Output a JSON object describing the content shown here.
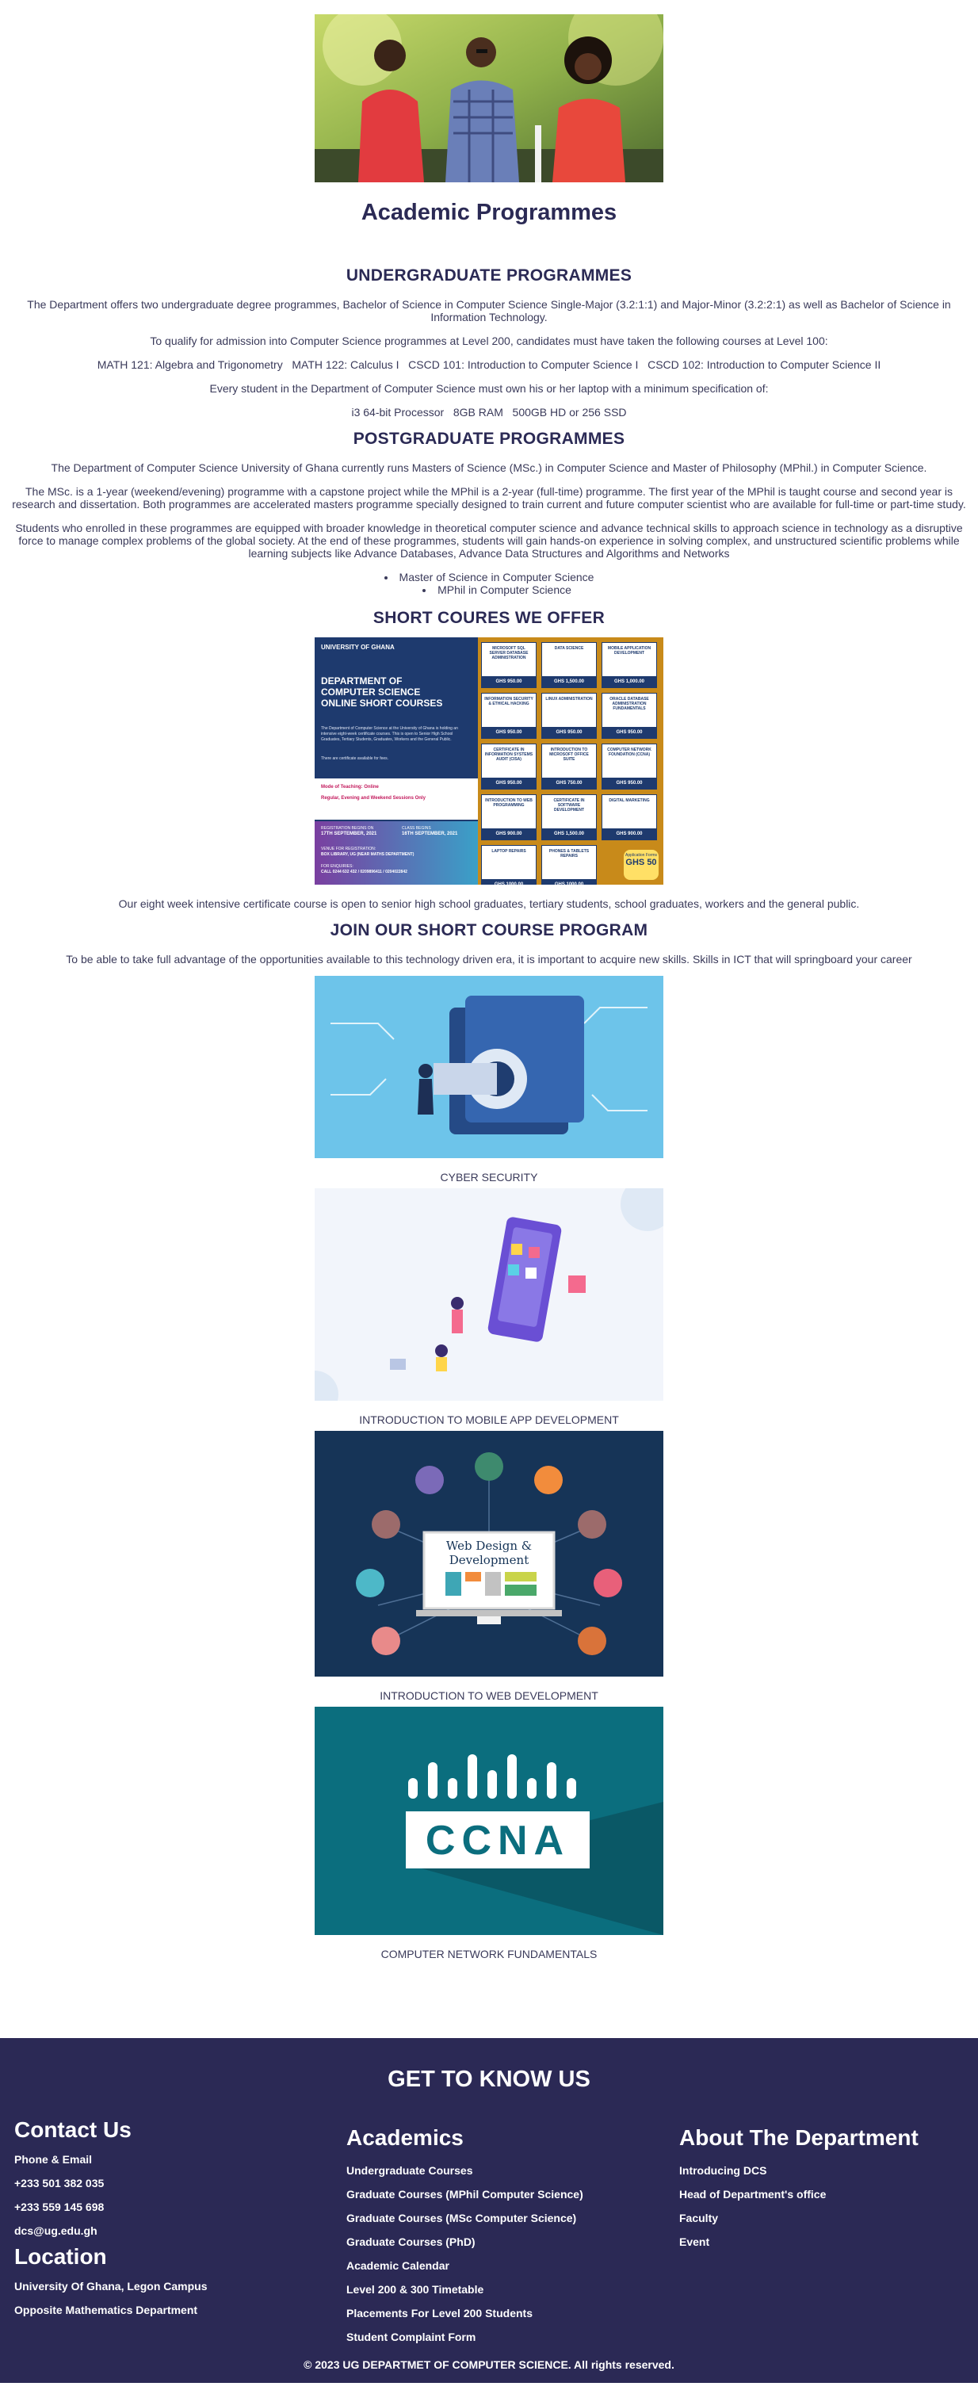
{
  "page": {
    "title": "Academic Programmes"
  },
  "undergrad": {
    "heading": "UNDERGRADUATE PROGRAMMES",
    "p1": "The Department offers two undergraduate degree programmes, Bachelor of Science in Computer Science Single-Major (3.2:1:1) and Major-Minor (3.2:2:1) as well as Bachelor of Science in Information Technology.",
    "p2": "To qualify for admission into Computer Science programmes at Level 200, candidates must have taken the following courses at Level 100:",
    "p3": "MATH 121: Algebra and Trigonometry   MATH 122: Calculus I   CSCD 101: Introduction to Computer Science I   CSCD 102: Introduction to Computer Science II",
    "p4": "Every student in the Department of Computer Science must own his or her laptop with a minimum specification of:",
    "p5": "i3 64-bit Processor   8GB RAM   500GB HD or 256 SSD"
  },
  "postgrad": {
    "heading": "POSTGRADUATE PROGRAMMES",
    "p1": "The Department of Computer Science University of Ghana currently runs Masters of Science (MSc.) in Computer Science and Master of Philosophy (MPhil.) in Computer Science.",
    "p2": "The MSc. is a 1-year (weekend/evening) programme with a capstone project while the MPhil is a 2-year (full-time) programme. The first year of the MPhil is taught course and second year is research and dissertation. Both programmes are accelerated masters programme specially designed to train current and future computer scientist who are available for full-time or part-time study.",
    "p3": "Students who enrolled in these programmes are equipped with broader knowledge in theoretical computer science and advance technical skills to approach science in technology as a disruptive force to manage complex problems of the global society. At the end of these programmes, students will gain hands-on experience in solving complex, and unstructured scientific problems while learning subjects like Advance Databases, Advance Data Structures and Algorithms and Networks",
    "items": [
      "Master of Science in Computer Science",
      "MPhil in Computer Science"
    ]
  },
  "short": {
    "heading": "SHORT COURES WE OFFER",
    "poster": {
      "brand": "UNIVERSITY OF GHANA",
      "title_lines": [
        "DEPARTMENT OF",
        "COMPUTER SCIENCE",
        "ONLINE SHORT COURSES"
      ],
      "intro": "The Department of Computer Science at the University of Ghana is holding an intensive eight-week certificate courses. This is open to Senior High School Graduates, Tertiary Students, Graduates, Workers and the General Public.",
      "contact_note": "There are certificate available for fees.",
      "mode_label": "Mode of Teaching: Online",
      "sessions": "Regular, Evening and Weekend Sessions Only",
      "reg_start_label": "REGISTRATION BEGINS ON",
      "reg_start": "17TH SEPTEMBER, 2021",
      "reg_end_label": "CLASS BEGINS",
      "reg_end": "16TH SEPTEMBER, 2021",
      "venue_label": "VENUE FOR REGISTRATION:",
      "venue": "BOX LIBRARY, UG (NEAR MATHS DEPARTMENT)",
      "enquiries_label": "FOR ENQUIRIES:",
      "enquiries": "CALL 0244 632 432 / 0209896411 / 0204022842",
      "courses": [
        {
          "name": "MICROSOFT SQL SERVER DATABASE ADMINISTRATION",
          "price": "GHS 950.00"
        },
        {
          "name": "DATA SCIENCE",
          "price": "GHS 1,500.00"
        },
        {
          "name": "MOBILE APPLICATION DEVELOPMENT",
          "price": "GHS 1,000.00"
        },
        {
          "name": "INFORMATION SECURITY & ETHICAL HACKING",
          "price": "GHS 950.00"
        },
        {
          "name": "LINUX ADMINISTRATION",
          "price": "GHS 950.00"
        },
        {
          "name": "ORACLE DATABASE ADMINISTRATION FUNDAMENTALS",
          "price": "GHS 950.00"
        },
        {
          "name": "CERTIFICATE IN INFORMATION SYSTEMS AUDIT (CISA)",
          "price": "GHS 950.00"
        },
        {
          "name": "INTRODUCTION TO MICROSOFT OFFICE SUITE",
          "price": "GHS 750.00"
        },
        {
          "name": "COMPUTER NETWORK FOUNDATION (CCNA)",
          "price": "GHS 950.00"
        },
        {
          "name": "INTRODUCTION TO WEB PROGRAMMING",
          "price": "GHS 900.00"
        },
        {
          "name": "CERTIFICATE IN SOFTWARE DEVELOPMENT",
          "price": "GHS 1,500.00"
        },
        {
          "name": "DIGITAL MARKETING",
          "price": "GHS 900.00"
        },
        {
          "name": "LAPTOP REPAIRS",
          "price": "GHS 1000.00"
        },
        {
          "name": "PHONES & TABLETS REPAIRS",
          "price": "GHS 1000.00"
        }
      ],
      "badge_label": "Application Forms",
      "badge_price": "GHS 50"
    },
    "note": "Our eight week intensive certificate course is open to senior high school graduates, tertiary students, school graduates, workers and the general public."
  },
  "join": {
    "heading": "JOIN OUR SHORT COURSE PROGRAM",
    "p1": "To be able to take full advantage of the opportunities available to this technology driven era, it is important to acquire new skills. Skills in ICT that will springboard your career",
    "courses": [
      {
        "caption": "CYBER SECURITY"
      },
      {
        "caption": "INTRODUCTION TO MOBILE APP DEVELOPMENT"
      },
      {
        "caption": "INTRODUCTION TO WEB DEVELOPMENT",
        "art_title_1": "Web Design &",
        "art_title_2": "Development"
      },
      {
        "caption": "COMPUTER NETWORK FUNDAMENTALS",
        "art_title": "CCNA"
      }
    ]
  },
  "footer": {
    "heading": "GET TO KNOW US",
    "contact": {
      "heading": "Contact Us",
      "phone_label": "Phone & Email",
      "phone1": "+233 501 382 035",
      "phone2": "+233 559 145 698",
      "email": "dcs@ug.edu.gh"
    },
    "location": {
      "heading": "Location",
      "line1": "University Of Ghana, Legon Campus",
      "line2": "Opposite Mathematics Department"
    },
    "academics": {
      "heading": "Academics",
      "links": [
        "Undergraduate Courses",
        "Graduate Courses (MPhil Computer Science)",
        "Graduate Courses (MSc Computer Science)",
        "Graduate Courses (PhD)",
        "Academic Calendar",
        "Level 200 & 300 Timetable",
        "Placements For Level 200 Students",
        "Student Complaint Form"
      ]
    },
    "about": {
      "heading": "About The Department",
      "links": [
        "Introducing DCS",
        "Head of Department's office",
        "Faculty",
        "Event"
      ]
    },
    "copyright": "© 2023 UG DEPARTMET OF COMPUTER SCIENCE. All rights reserved."
  },
  "colors": {
    "heading": "#2b2a55",
    "footer_bg": "#2b2955",
    "body_text": "#3a3a5a"
  }
}
